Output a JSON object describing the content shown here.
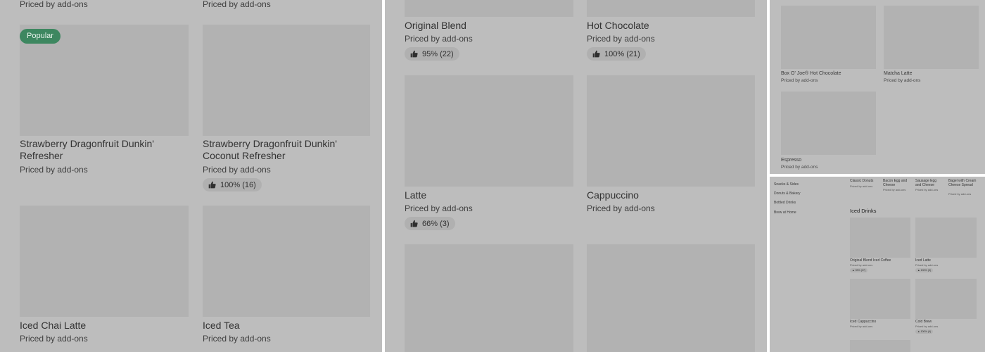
{
  "common": {
    "priced": "Priced by add-ons"
  },
  "panel_a": {
    "top_left_sub": "Priced by add-ons",
    "top_right_sub": "Priced by add-ons",
    "badge": "Popular",
    "items": [
      {
        "title": "Strawberry Dragonfruit Dunkin' Refresher",
        "sub": "Priced by add-ons"
      },
      {
        "title": "Strawberry Dragonfruit Dunkin' Coconut Refresher",
        "sub": "Priced by add-ons",
        "rating": "100% (16)"
      },
      {
        "title": "Iced Chai Latte",
        "sub": "Priced by add-ons"
      },
      {
        "title": "Iced Tea",
        "sub": "Priced by add-ons"
      }
    ]
  },
  "panel_b": {
    "items": [
      {
        "title": "Original Blend",
        "sub": "Priced by add-ons",
        "rating": "95% (22)"
      },
      {
        "title": "Hot Chocolate",
        "sub": "Priced by add-ons",
        "rating": "100% (21)"
      },
      {
        "title": "Latte",
        "sub": "Priced by add-ons",
        "rating": "66% (3)"
      },
      {
        "title": "Cappuccino",
        "sub": "Priced by add-ons"
      }
    ]
  },
  "panel_c": {
    "items": [
      {
        "title": "Box O' Joe® Hot Chocolate",
        "sub": "Priced by add-ons"
      },
      {
        "title": "Matcha Latte",
        "sub": "Priced by add-ons"
      },
      {
        "title": "Espresso",
        "sub": "Priced by add-ons"
      }
    ]
  },
  "panel_d": {
    "sidebar": [
      "Snacks & Sides",
      "Donuts & Bakery",
      "Bottled Drinks",
      "Brew at Home"
    ],
    "top_items": [
      {
        "title": "Classic Donuts",
        "sub": "Priced by add-ons"
      },
      {
        "title": "Bacon Egg and Cheese",
        "sub": "Priced by add-ons"
      },
      {
        "title": "Sausage Egg and Cheese",
        "sub": "Priced by add-ons"
      },
      {
        "title": "Bagel with Cream Cheese Spread",
        "sub": "Priced by add-ons"
      }
    ],
    "section_title": "Iced Drinks",
    "items": [
      {
        "title": "Original Blend Iced Coffee",
        "sub": "Priced by add-ons",
        "rating": "93% (27)"
      },
      {
        "title": "Iced Latte",
        "sub": "Priced by add-ons",
        "rating": "100% (3)"
      },
      {
        "title": "Iced Cappuccino",
        "sub": "Priced by add-ons"
      },
      {
        "title": "Cold Brew",
        "sub": "Priced by add-ons",
        "rating": "100% (4)"
      }
    ]
  },
  "icons": {
    "rating": "thumbs-up-icon"
  },
  "colors": {
    "badge": "#3d8760",
    "overlay": "#bdbdbd",
    "placeholder": "#b2b2b2"
  }
}
